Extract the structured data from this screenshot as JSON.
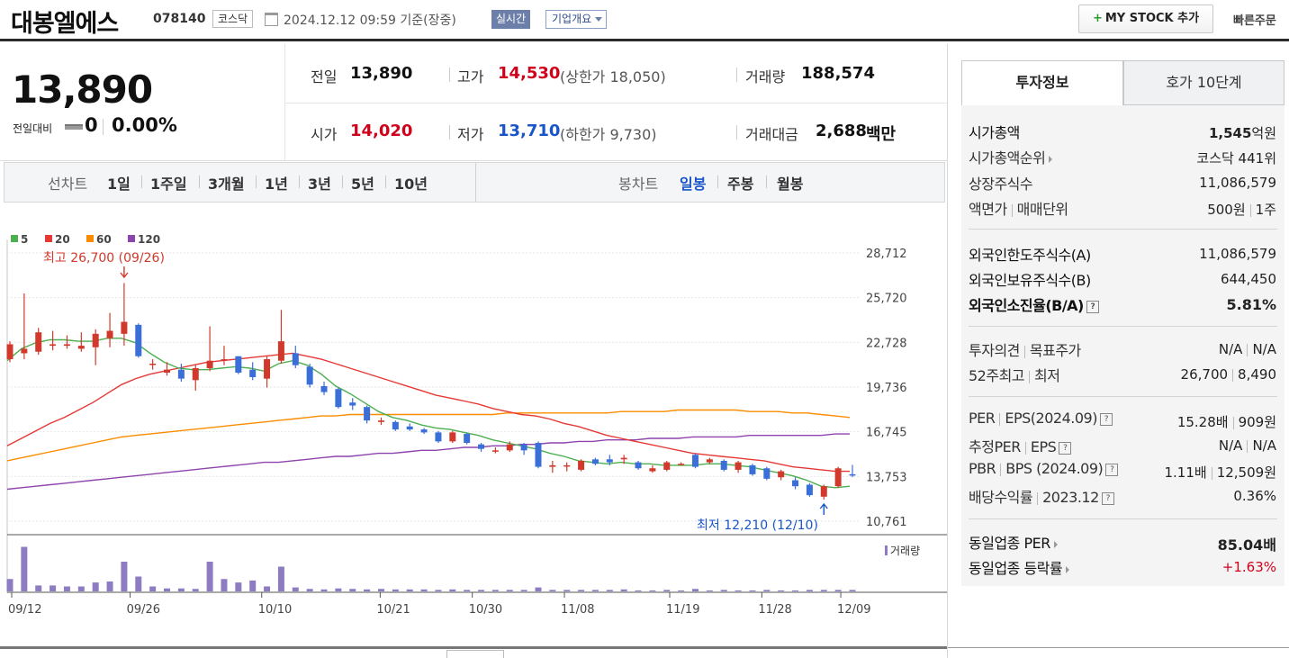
{
  "header": {
    "company_name": "대봉엘에스",
    "stock_code": "078140",
    "market": "코스닥",
    "timestamp": "2024.12.12 09:59 기준(장중)",
    "realtime": "실시간",
    "company_info": "기업개요",
    "mystock_button": "MY STOCK 추가",
    "quick_order": "빠른주문"
  },
  "price": {
    "current": "13,890",
    "change_label": "전일대비",
    "change_value": "0",
    "change_rate": "0.00%",
    "prev_label": "전일",
    "prev_value": "13,890",
    "high_label": "고가",
    "high_value": "14,530",
    "upper_limit": "(상한가 18,050)",
    "volume_label": "거래량",
    "volume_value": "188,574",
    "open_label": "시가",
    "open_value": "14,020",
    "low_label": "저가",
    "low_value": "13,710",
    "lower_limit": "(하한가 9,730)",
    "amount_label": "거래대금",
    "amount_value": "2,688",
    "amount_unit": "백만"
  },
  "chart_tabs": {
    "line_label": "선차트",
    "line_periods": [
      "1일",
      "1주일",
      "3개월",
      "1년",
      "3년",
      "5년",
      "10년"
    ],
    "candle_label": "봉차트",
    "candle_periods": [
      "일봉",
      "주봉",
      "월봉"
    ],
    "selected_candle": "일봉"
  },
  "chart_data": {
    "type": "candlestick",
    "legend": [
      "5",
      "20",
      "60",
      "120"
    ],
    "legend_colors": [
      "#4caf50",
      "#e53935",
      "#fb8c00",
      "#8e44ad"
    ],
    "y_ticks": [
      "28,712",
      "25,720",
      "22,728",
      "19,736",
      "16,745",
      "13,753",
      "10,761"
    ],
    "ylim": [
      10761,
      28712
    ],
    "x_ticks": [
      "09/12",
      "09/26",
      "10/10",
      "10/21",
      "10/30",
      "11/08",
      "11/19",
      "11/28",
      "12/09"
    ],
    "max_annotation": "최고 26,700 (09/26)",
    "min_annotation": "최저 12,210 (12/10)",
    "volume_label": "거래량",
    "candles": [
      {
        "o": 21600,
        "c": 22600,
        "h": 22800,
        "l": 21400
      },
      {
        "o": 22000,
        "c": 22300,
        "h": 26000,
        "l": 21600
      },
      {
        "o": 22100,
        "c": 23400,
        "h": 23700,
        "l": 21900
      },
      {
        "o": 22500,
        "c": 22600,
        "h": 23500,
        "l": 22200
      },
      {
        "o": 22500,
        "c": 22600,
        "h": 23200,
        "l": 22300
      },
      {
        "o": 22300,
        "c": 22500,
        "h": 23400,
        "l": 22100
      },
      {
        "o": 22400,
        "c": 23300,
        "h": 23600,
        "l": 21200
      },
      {
        "o": 23000,
        "c": 23500,
        "h": 24700,
        "l": 22400
      },
      {
        "o": 23300,
        "c": 24100,
        "h": 26700,
        "l": 22500
      },
      {
        "o": 23900,
        "c": 21800,
        "h": 24000,
        "l": 21700
      },
      {
        "o": 21300,
        "c": 21300,
        "h": 21600,
        "l": 20900
      },
      {
        "o": 20700,
        "c": 20900,
        "h": 21400,
        "l": 20500
      },
      {
        "o": 20900,
        "c": 20300,
        "h": 21300,
        "l": 20100
      },
      {
        "o": 20200,
        "c": 21000,
        "h": 21200,
        "l": 19500
      },
      {
        "o": 21000,
        "c": 21500,
        "h": 23800,
        "l": 20800
      },
      {
        "o": 21500,
        "c": 21600,
        "h": 22500,
        "l": 21200
      },
      {
        "o": 21800,
        "c": 20700,
        "h": 21800,
        "l": 20600
      },
      {
        "o": 20900,
        "c": 20400,
        "h": 21400,
        "l": 20200
      },
      {
        "o": 20300,
        "c": 21600,
        "h": 21800,
        "l": 19700
      },
      {
        "o": 21500,
        "c": 22800,
        "h": 24900,
        "l": 21300
      },
      {
        "o": 22000,
        "c": 21200,
        "h": 22500,
        "l": 21000
      },
      {
        "o": 21100,
        "c": 19900,
        "h": 21300,
        "l": 19700
      },
      {
        "o": 19800,
        "c": 19400,
        "h": 20100,
        "l": 19200
      },
      {
        "o": 19600,
        "c": 18400,
        "h": 19700,
        "l": 18300
      },
      {
        "o": 18700,
        "c": 18500,
        "h": 19000,
        "l": 18200
      },
      {
        "o": 18400,
        "c": 17500,
        "h": 18500,
        "l": 17300
      },
      {
        "o": 17400,
        "c": 17500,
        "h": 17700,
        "l": 17200
      },
      {
        "o": 17400,
        "c": 16900,
        "h": 17500,
        "l": 16800
      },
      {
        "o": 17100,
        "c": 16900,
        "h": 17300,
        "l": 16800
      },
      {
        "o": 16900,
        "c": 16700,
        "h": 17000,
        "l": 16600
      },
      {
        "o": 16700,
        "c": 16100,
        "h": 16800,
        "l": 16000
      },
      {
        "o": 16100,
        "c": 16700,
        "h": 16800,
        "l": 16000
      },
      {
        "o": 16600,
        "c": 16000,
        "h": 16700,
        "l": 15900
      },
      {
        "o": 15900,
        "c": 15600,
        "h": 16000,
        "l": 15400
      },
      {
        "o": 15500,
        "c": 15500,
        "h": 15700,
        "l": 15300
      },
      {
        "o": 15500,
        "c": 15900,
        "h": 16100,
        "l": 15400
      },
      {
        "o": 15900,
        "c": 15500,
        "h": 16000,
        "l": 15200
      },
      {
        "o": 16000,
        "c": 14400,
        "h": 16100,
        "l": 14300
      },
      {
        "o": 14400,
        "c": 14500,
        "h": 14800,
        "l": 14000
      },
      {
        "o": 14500,
        "c": 14500,
        "h": 14700,
        "l": 14100
      },
      {
        "o": 14200,
        "c": 14800,
        "h": 14900,
        "l": 14100
      },
      {
        "o": 14900,
        "c": 14600,
        "h": 15000,
        "l": 14500
      },
      {
        "o": 14900,
        "c": 14700,
        "h": 15200,
        "l": 14500
      },
      {
        "o": 14900,
        "c": 15000,
        "h": 15200,
        "l": 14600
      },
      {
        "o": 14700,
        "c": 14300,
        "h": 14800,
        "l": 14200
      },
      {
        "o": 14100,
        "c": 14300,
        "h": 14500,
        "l": 14000
      },
      {
        "o": 14200,
        "c": 14700,
        "h": 14800,
        "l": 14100
      },
      {
        "o": 14600,
        "c": 14600,
        "h": 14700,
        "l": 14500
      },
      {
        "o": 15200,
        "c": 14400,
        "h": 15300,
        "l": 14300
      },
      {
        "o": 14700,
        "c": 14900,
        "h": 15000,
        "l": 14600
      },
      {
        "o": 14800,
        "c": 14200,
        "h": 14900,
        "l": 14100
      },
      {
        "o": 14200,
        "c": 14700,
        "h": 14800,
        "l": 14000
      },
      {
        "o": 14500,
        "c": 13900,
        "h": 14600,
        "l": 13800
      },
      {
        "o": 14300,
        "c": 13600,
        "h": 14400,
        "l": 13500
      },
      {
        "o": 13700,
        "c": 14100,
        "h": 14200,
        "l": 13500
      },
      {
        "o": 13500,
        "c": 13100,
        "h": 13700,
        "l": 12900
      },
      {
        "o": 13200,
        "c": 12500,
        "h": 13300,
        "l": 12400
      },
      {
        "o": 12400,
        "c": 13100,
        "h": 13200,
        "l": 12210
      },
      {
        "o": 13100,
        "c": 14300,
        "h": 14400,
        "l": 13000
      },
      {
        "o": 13900,
        "c": 13890,
        "h": 14530,
        "l": 13710
      }
    ],
    "volumes": [
      0.25,
      0.9,
      0.12,
      0.12,
      0.1,
      0.1,
      0.18,
      0.2,
      0.6,
      0.3,
      0.1,
      0.06,
      0.06,
      0.05,
      0.6,
      0.25,
      0.18,
      0.22,
      0.1,
      0.5,
      0.08,
      0.05,
      0.04,
      0.06,
      0.05,
      0.04,
      0.05,
      0.04,
      0.04,
      0.04,
      0.03,
      0.04,
      0.03,
      0.03,
      0.03,
      0.03,
      0.03,
      0.08,
      0.03,
      0.03,
      0.03,
      0.03,
      0.03,
      0.04,
      0.02,
      0.02,
      0.03,
      0.02,
      0.05,
      0.02,
      0.03,
      0.02,
      0.02,
      0.03,
      0.02,
      0.02,
      0.03,
      0.03,
      0.03,
      0.03
    ],
    "ma5": [
      21500,
      22300,
      22700,
      22900,
      22900,
      22800,
      22800,
      23000,
      23000,
      22700,
      22000,
      21400,
      21000,
      20900,
      20900,
      21000,
      21100,
      21000,
      20800,
      21300,
      21500,
      21200,
      20600,
      19800,
      19300,
      18700,
      18100,
      17700,
      17500,
      17200,
      17000,
      16900,
      16700,
      16500,
      16200,
      16000,
      15800,
      15600,
      15300,
      15100,
      14800,
      14700,
      14600,
      14700,
      14600,
      14600,
      14500,
      14500,
      14500,
      14600,
      14600,
      14500,
      14400,
      14200,
      14000,
      13800,
      13500,
      13100,
      13000,
      13100
    ],
    "ma20": [
      15800,
      16300,
      16800,
      17300,
      17700,
      18200,
      18700,
      19300,
      19900,
      20300,
      20600,
      20800,
      21000,
      21200,
      21400,
      21500,
      21600,
      21700,
      21800,
      21900,
      22000,
      21800,
      21600,
      21300,
      21000,
      20700,
      20400,
      20100,
      19800,
      19500,
      19200,
      19000,
      18800,
      18600,
      18300,
      18100,
      17900,
      17800,
      17600,
      17300,
      17100,
      16800,
      16500,
      16300,
      16100,
      15900,
      15700,
      15500,
      15300,
      15200,
      15100,
      15000,
      14900,
      14800,
      14600,
      14400,
      14300,
      14200,
      14100,
      14100
    ],
    "ma60": [
      14800,
      15000,
      15200,
      15400,
      15600,
      15800,
      16000,
      16200,
      16400,
      16500,
      16600,
      16700,
      16800,
      16900,
      17000,
      17100,
      17200,
      17300,
      17400,
      17500,
      17600,
      17700,
      17800,
      17800,
      17900,
      17900,
      17900,
      17900,
      17900,
      17900,
      17900,
      17900,
      17900,
      17900,
      17900,
      18000,
      18000,
      18000,
      18000,
      18000,
      18000,
      18000,
      18000,
      18100,
      18100,
      18100,
      18100,
      18200,
      18200,
      18200,
      18200,
      18200,
      18100,
      18100,
      18100,
      18000,
      18000,
      17900,
      17800,
      17700
    ],
    "ma120": [
      12900,
      13000,
      13100,
      13200,
      13300,
      13400,
      13500,
      13600,
      13700,
      13800,
      13900,
      14000,
      14100,
      14200,
      14300,
      14400,
      14500,
      14600,
      14700,
      14700,
      14800,
      14900,
      15000,
      15100,
      15100,
      15200,
      15300,
      15300,
      15400,
      15500,
      15500,
      15600,
      15700,
      15700,
      15800,
      15800,
      15900,
      15900,
      16000,
      16000,
      16100,
      16100,
      16200,
      16200,
      16200,
      16300,
      16300,
      16300,
      16400,
      16400,
      16400,
      16400,
      16500,
      16500,
      16500,
      16500,
      16500,
      16500,
      16600,
      16600
    ]
  },
  "invest": {
    "tab_invest": "투자정보",
    "tab_orderbook": "호가 10단계",
    "market_cap_label": "시가총액",
    "market_cap_value": "1,545",
    "market_cap_unit": "억원",
    "rank_label": "시가총액순위",
    "rank_value": "코스닥 441위",
    "shares_label": "상장주식수",
    "shares_value": "11,086,579",
    "par_label": "액면가",
    "par_label2": "매매단위",
    "par_value": "500원",
    "par_value2": "1주",
    "foreign_limit_label": "외국인한도주식수(A)",
    "foreign_limit_value": "11,086,579",
    "foreign_hold_label": "외국인보유주식수(B)",
    "foreign_hold_value": "644,450",
    "foreign_ratio_label": "외국인소진율(B/A)",
    "foreign_ratio_value": "5.81%",
    "opinion_label": "투자의견",
    "opinion_label2": "목표주가",
    "opinion_value": "N/A",
    "opinion_value2": "N/A",
    "w52_label": "52주최고",
    "w52_label2": "최저",
    "w52_value": "26,700",
    "w52_value2": "8,490",
    "per_label": "PER",
    "per_label2": "EPS(2024.09)",
    "per_value": "15.28배",
    "per_value2": "909원",
    "est_per_label": "추정PER",
    "est_per_label2": "EPS",
    "est_per_value": "N/A",
    "est_per_value2": "N/A",
    "pbr_label": "PBR",
    "pbr_label2": "BPS (2024.09)",
    "pbr_value": "1.11배",
    "pbr_value2": "12,509원",
    "div_label": "배당수익률",
    "div_label2": "2023.12",
    "div_value": "0.36%",
    "sector_per_label": "동일업종 PER",
    "sector_per_value": "85.04배",
    "sector_rate_label": "동일업종 등락률",
    "sector_rate_value": "+1.63%"
  }
}
